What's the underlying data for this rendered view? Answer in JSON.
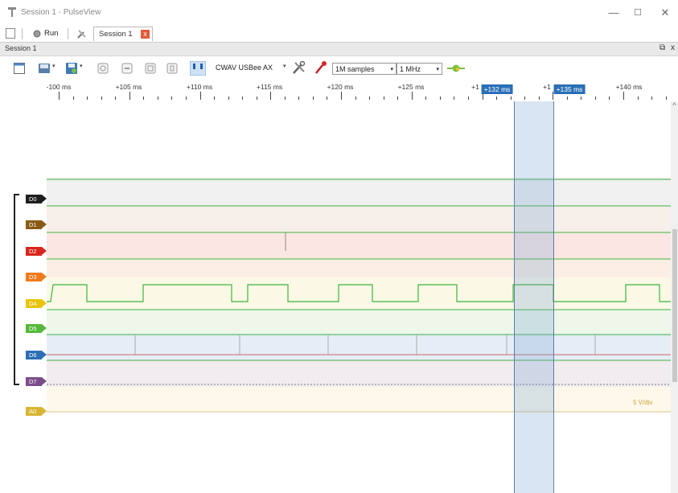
{
  "window": {
    "title": "Session 1 - PulseView",
    "minimize_glyph": "—",
    "maximize_glyph": "☐",
    "close_glyph": "✕"
  },
  "tabbar": {
    "run_label": "Run",
    "session_tab_label": "Session 1",
    "close_glyph": "x"
  },
  "sessionbar": {
    "label": "Session 1",
    "float_glyph": "⧉",
    "close_glyph": "x"
  },
  "toolbar": {
    "device": "CWAV USBee AX",
    "samples": "1M samples",
    "samplerate": "1 MHz",
    "dropdown_glyph": "▾"
  },
  "ruler": {
    "ticks": [
      "-100 ms",
      "+105 ms",
      "+110 ms",
      "+115 ms",
      "+120 ms",
      "+125 ms",
      "+1",
      "+1",
      "+140 ms"
    ],
    "cursor1": "+132 ms",
    "cursor2": "+135 ms"
  },
  "channels": [
    {
      "name": "D0",
      "color": "#1e1e1e"
    },
    {
      "name": "D1",
      "color": "#8a5a14"
    },
    {
      "name": "D2",
      "color": "#d9261c"
    },
    {
      "name": "D3",
      "color": "#f07b1c"
    },
    {
      "name": "D4",
      "color": "#e8c40e"
    },
    {
      "name": "D5",
      "color": "#56b83a"
    },
    {
      "name": "D6",
      "color": "#2c6eb4"
    },
    {
      "name": "D7",
      "color": "#7b4c8a"
    },
    {
      "name": "A0",
      "color": "#d9b531"
    }
  ],
  "analog": {
    "scale": "5 V/div"
  },
  "colors": {
    "cursor_flag": "#2a6fb6",
    "trace_green": "#3cb53c"
  }
}
